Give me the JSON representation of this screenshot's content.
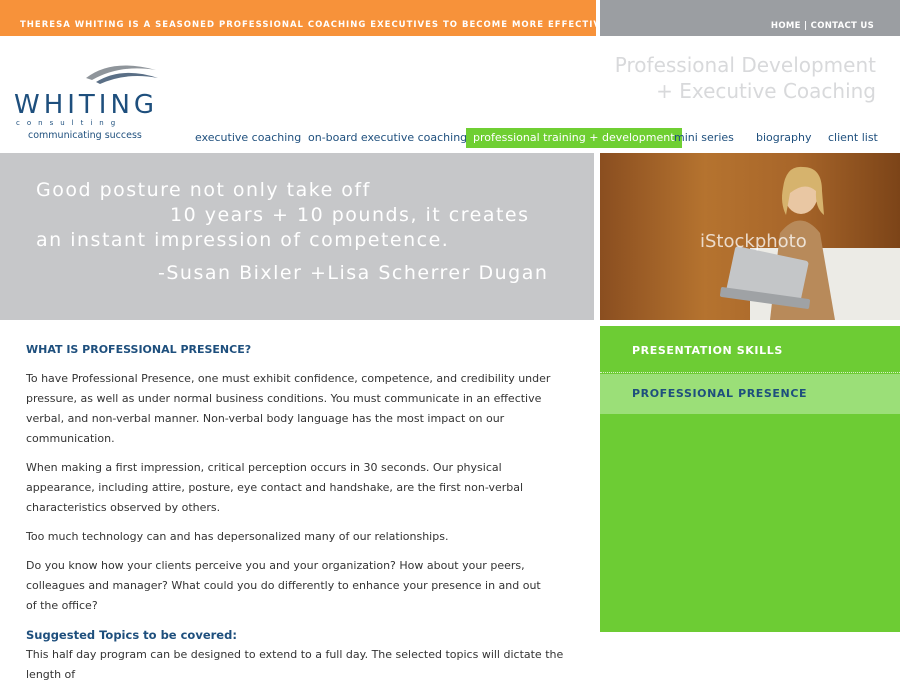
{
  "header": {
    "tagline": "THERESA WHITING IS A SEASONED PROFESSIONAL COACHING EXECUTIVES TO BECOME MORE EFFECTIVE LEADERS.",
    "links": {
      "home": "HOME",
      "separator": "|",
      "contact": "CONTACT US"
    },
    "headline_line1": "Professional Development",
    "headline_line2": "+ Executive Coaching"
  },
  "logo": {
    "word": "WHITING",
    "sub": "consulting",
    "tagline": "communicating success"
  },
  "nav": {
    "items": [
      "executive coaching",
      "on-board executive coaching",
      "professional training + development",
      "mini series",
      "biography",
      "client list"
    ],
    "active_index": 2
  },
  "quote": {
    "line1": "Good posture not only take off",
    "line2": "10 years + 10 pounds, it creates",
    "line3": "an instant impression of competence.",
    "attribution": "-Susan Bixler +Lisa Scherrer Dugan"
  },
  "photo": {
    "watermark": "iStockphoto"
  },
  "sidenav": {
    "items": [
      "PRESENTATION SKILLS",
      "PROFESSIONAL PRESENCE"
    ],
    "active_index": 1
  },
  "content": {
    "heading": "WHAT IS PROFESSIONAL PRESENCE?",
    "p1": "To have Professional Presence, one must exhibit confidence, competence, and credibility under pressure, as well as under normal business conditions. You must communicate in an effective verbal, and non-verbal manner. Non-verbal body language has the most impact on our communication.",
    "p2": "When making a first impression, critical perception occurs in 30 seconds. Our physical appearance, including attire, posture, eye contact and handshake, are the first non-verbal characteristics observed by others.",
    "p3": "Too much technology can and has depersonalized many of our relationships.",
    "p4a": "Do you know how your clients perceive you and your organization? How about your peers, colleagues and manager? What could you do differently to enhance your presence in and out",
    "p4b": "of the office?",
    "subheading": "Suggested Topics to be covered:",
    "p5": "This half day program can be designed to extend to a full day. The selected topics will dictate the length of"
  },
  "colors": {
    "orange": "#f7923a",
    "green": "#6dcc34",
    "navy": "#1e4f7d",
    "gray": "#c6c7c9"
  }
}
